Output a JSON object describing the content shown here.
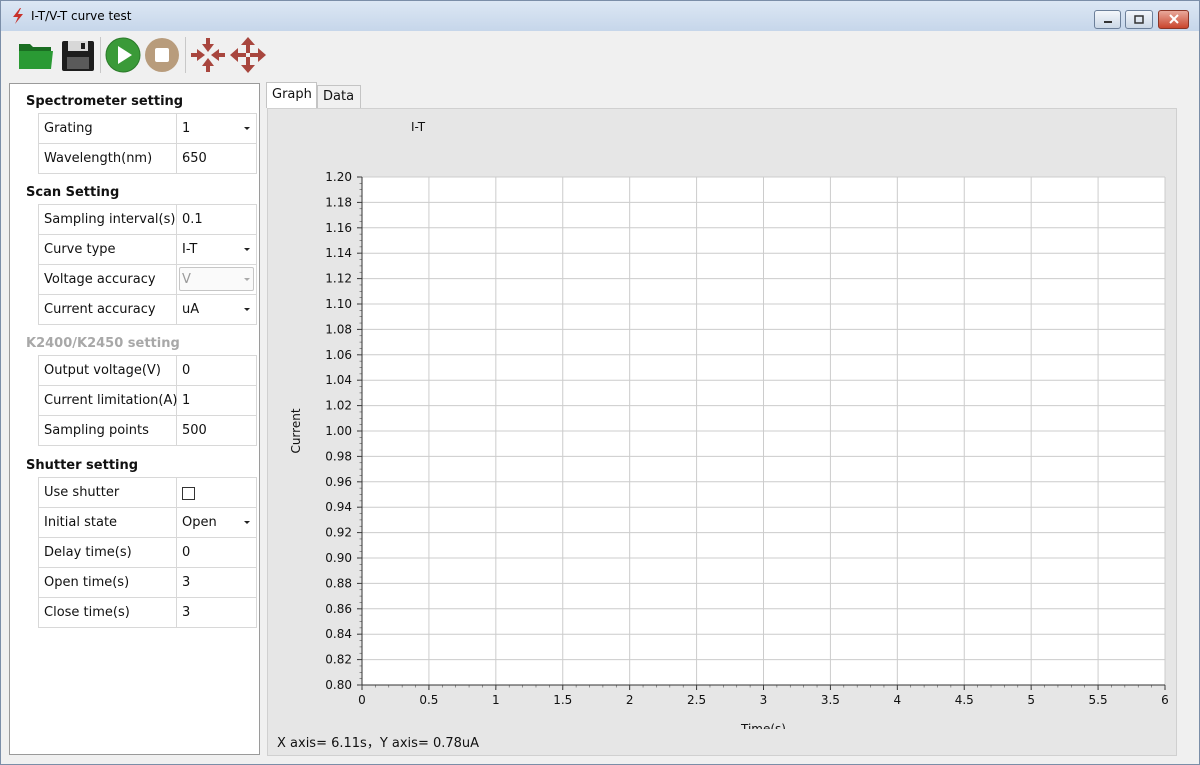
{
  "window": {
    "title": "I-T/V-T curve test",
    "minimize_icon": "minimize-icon",
    "maximize_icon": "maximize-icon",
    "close_icon": "close-icon"
  },
  "toolbar": {
    "buttons": [
      {
        "name": "open-folder-button",
        "icon": "folder-open-icon",
        "color": "#1f8a2a"
      },
      {
        "name": "save-button",
        "icon": "floppy-disk-icon",
        "color": "#222222"
      },
      {
        "name": "start-button",
        "icon": "play-icon",
        "color": "#3c9b3a"
      },
      {
        "name": "stop-button",
        "icon": "stop-icon",
        "color": "#b49a7a"
      },
      {
        "name": "zoom-in-button",
        "icon": "arrows-inward-icon",
        "color": "#a8463e"
      },
      {
        "name": "zoom-out-button",
        "icon": "arrows-outward-icon",
        "color": "#a8463e"
      }
    ]
  },
  "left_panel": {
    "spectrometer": {
      "title": "Spectrometer setting",
      "rows": [
        {
          "label": "Grating",
          "value": "1",
          "type": "dropdown"
        },
        {
          "label": "Wavelength(nm)",
          "value": "650",
          "type": "text"
        }
      ]
    },
    "scan": {
      "title": "Scan Setting",
      "rows": [
        {
          "label": "Sampling interval(s)",
          "value": "0.1",
          "type": "text"
        },
        {
          "label": "Curve type",
          "value": "I-T",
          "type": "dropdown"
        },
        {
          "label": "Voltage accuracy",
          "value": "V",
          "type": "dropdown-disabled"
        },
        {
          "label": "Current accuracy",
          "value": "uA",
          "type": "dropdown"
        }
      ]
    },
    "k2400": {
      "title": "K2400/K2450 setting",
      "rows": [
        {
          "label": "Output voltage(V)",
          "value": "0",
          "type": "text"
        },
        {
          "label": "Current limitation(A)",
          "value": "1",
          "type": "text"
        },
        {
          "label": "Sampling points",
          "value": "500",
          "type": "text"
        }
      ]
    },
    "shutter": {
      "title": "Shutter setting",
      "rows": [
        {
          "label": "Use shutter",
          "value": "",
          "type": "checkbox",
          "checked": false
        },
        {
          "label": "Initial state",
          "value": "Open",
          "type": "dropdown"
        },
        {
          "label": "Delay time(s)",
          "value": "0",
          "type": "text"
        },
        {
          "label": "Open time(s)",
          "value": "3",
          "type": "text"
        },
        {
          "label": "Close time(s)",
          "value": "3",
          "type": "text"
        }
      ]
    }
  },
  "tabs": [
    {
      "label": "Graph",
      "active": true
    },
    {
      "label": "Data",
      "active": false
    }
  ],
  "graph": {
    "status": "X axis= 6.11s，Y axis= 0.78uA"
  },
  "chart_data": {
    "type": "line",
    "title": "I-T",
    "xlabel": "Time(s)",
    "ylabel": "Current",
    "xlim": [
      0,
      6
    ],
    "ylim": [
      0.8,
      1.2
    ],
    "x_ticks": [
      "0",
      "0.5",
      "1",
      "1.5",
      "2",
      "2.5",
      "3",
      "3.5",
      "4",
      "4.5",
      "5",
      "5.5",
      "6"
    ],
    "y_ticks": [
      "1.20",
      "1.18",
      "1.16",
      "1.14",
      "1.12",
      "1.10",
      "1.08",
      "1.06",
      "1.04",
      "1.02",
      "1.00",
      "0.98",
      "0.96",
      "0.94",
      "0.92",
      "0.90",
      "0.88",
      "0.86",
      "0.84",
      "0.82",
      "0.80"
    ],
    "grid": true,
    "series": [],
    "colors": {
      "plot_bg": "#ffffff",
      "grid": "#cccccc",
      "panel_bg": "#e6e6e6"
    }
  }
}
